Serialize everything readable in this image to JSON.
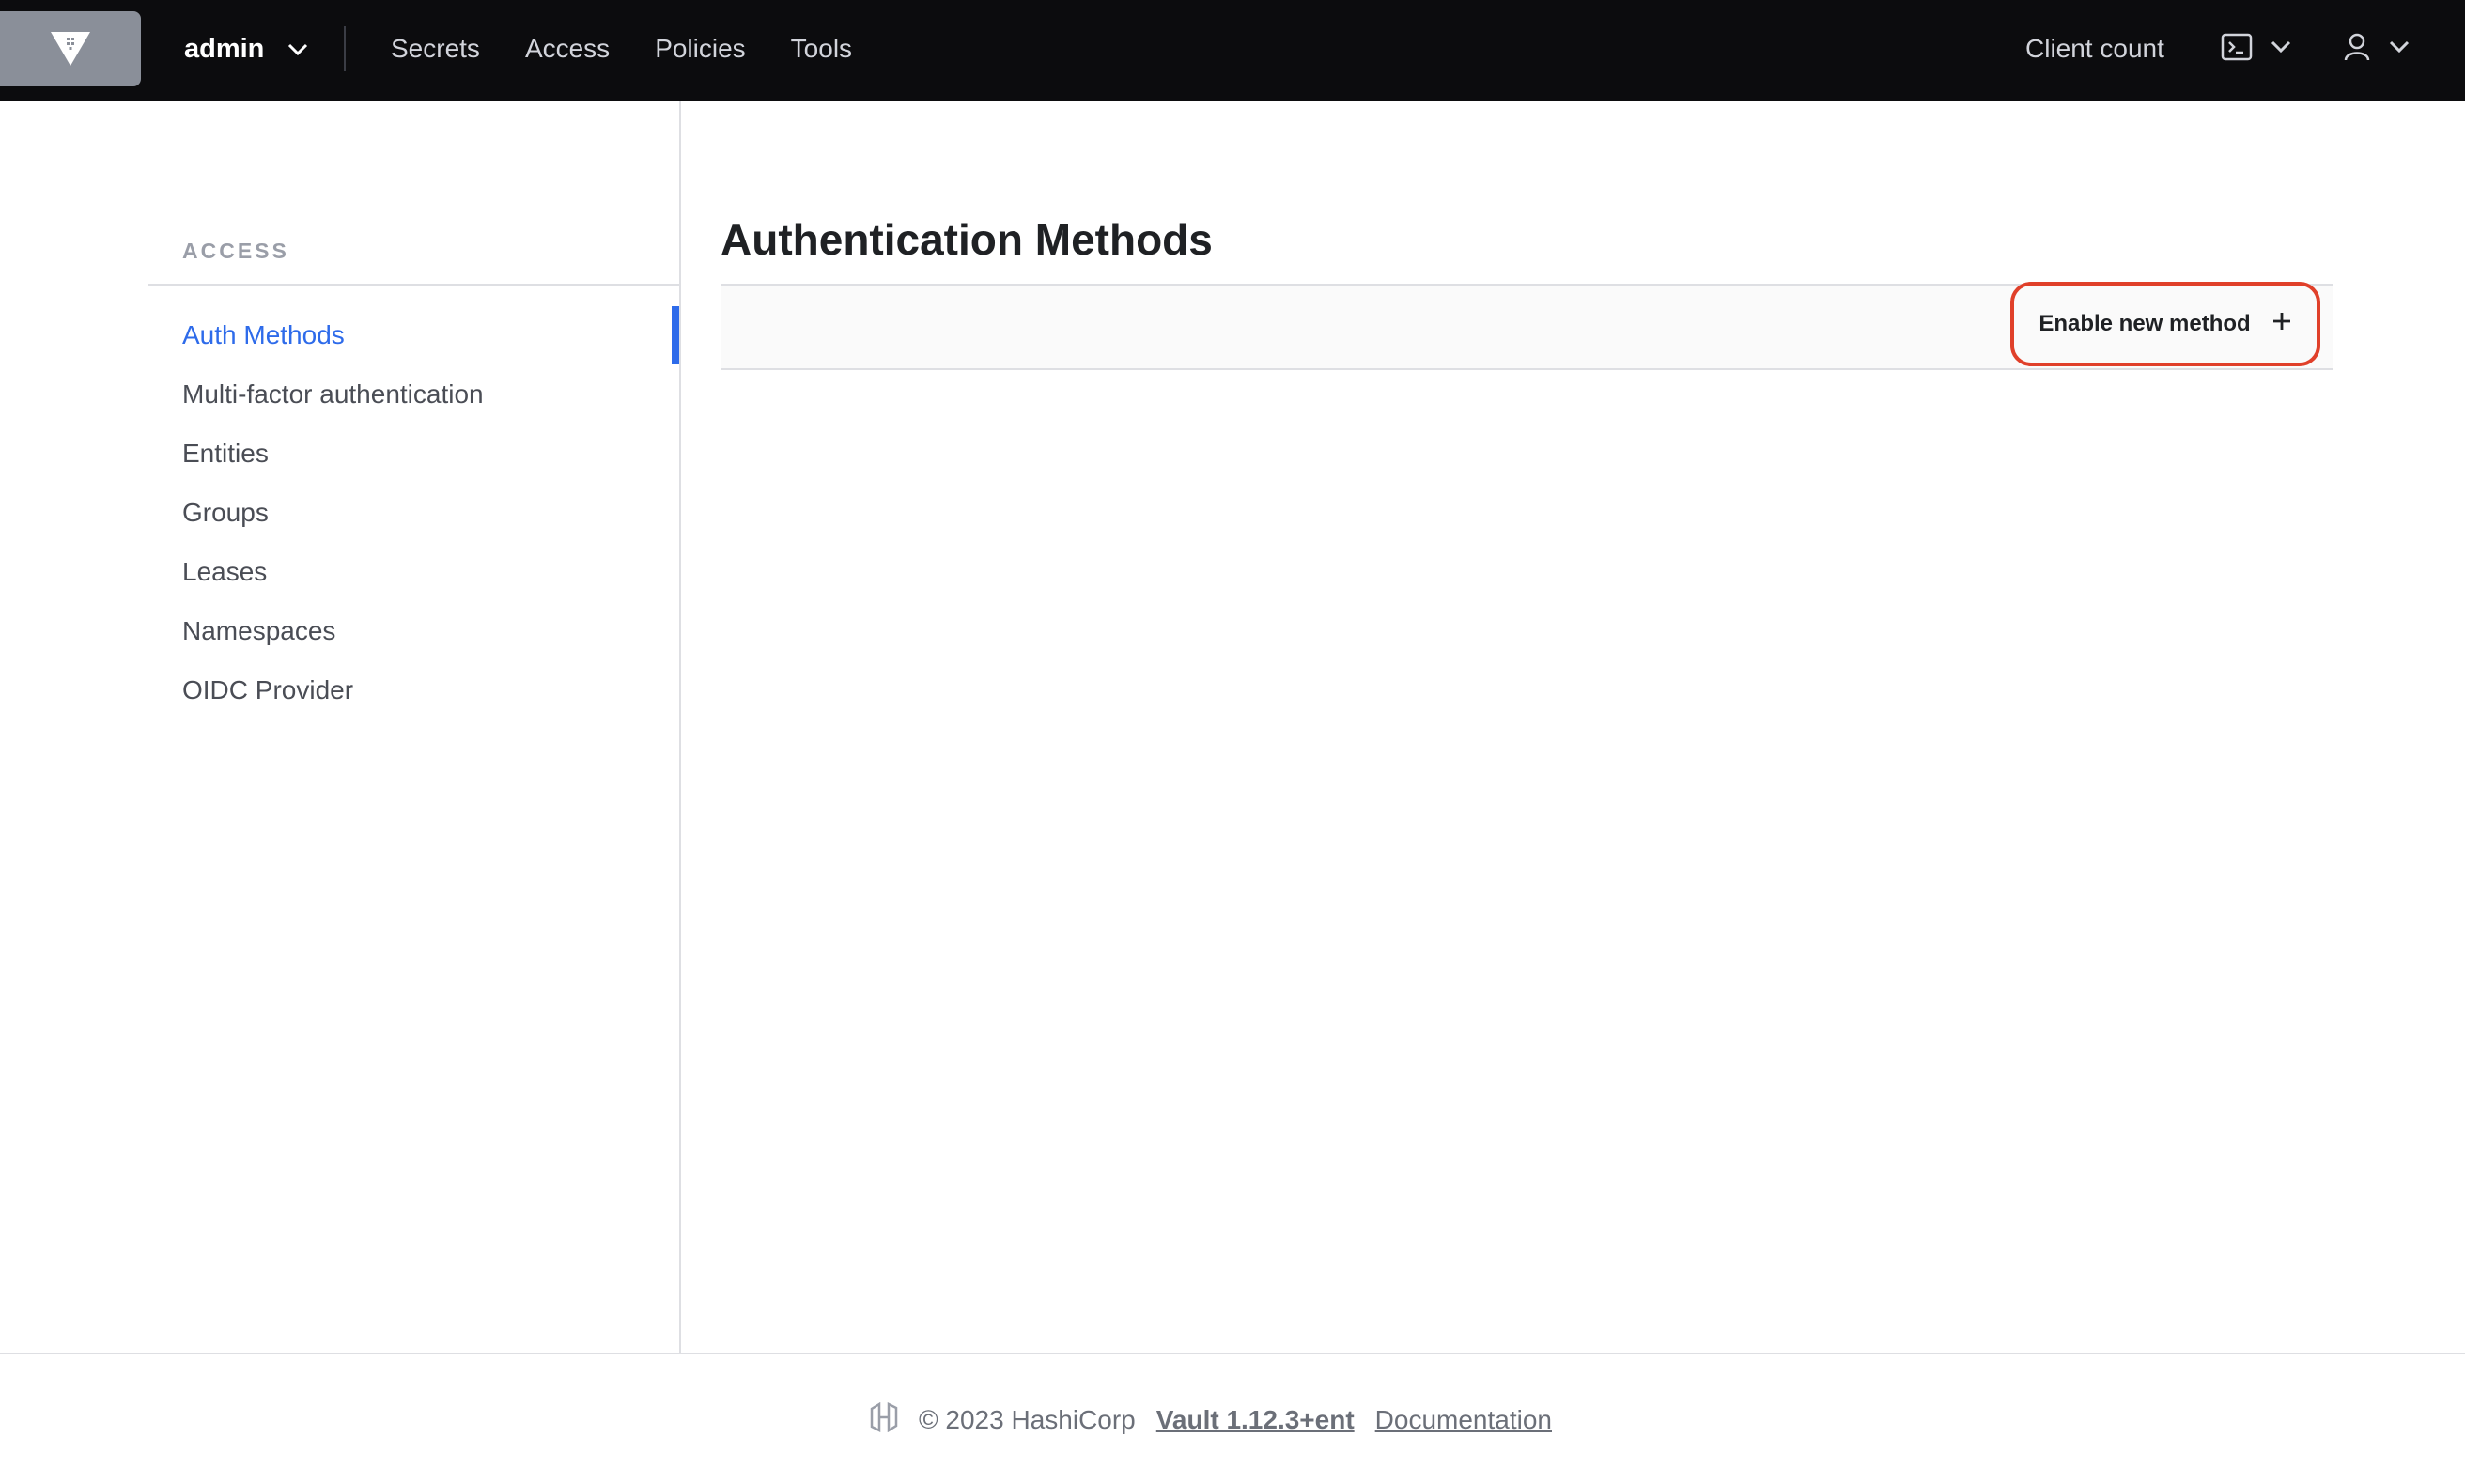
{
  "header": {
    "namespace": "admin",
    "nav_links": [
      "Secrets",
      "Access",
      "Policies",
      "Tools"
    ],
    "client_count": "Client count",
    "icons": {
      "logo": "vault-logo-icon",
      "namespace_caret": "chevron-down-icon",
      "console": "terminal-icon",
      "user": "user-icon"
    }
  },
  "sidebar": {
    "heading": "ACCESS",
    "items": [
      {
        "label": "Auth Methods",
        "active": true
      },
      {
        "label": "Multi-factor authentication",
        "active": false
      },
      {
        "label": "Entities",
        "active": false
      },
      {
        "label": "Groups",
        "active": false
      },
      {
        "label": "Leases",
        "active": false
      },
      {
        "label": "Namespaces",
        "active": false
      },
      {
        "label": "OIDC Provider",
        "active": false
      }
    ]
  },
  "main": {
    "title": "Authentication Methods",
    "enable_button": "Enable new method"
  },
  "footer": {
    "copyright": "© 2023 HashiCorp",
    "version": "Vault 1.12.3+ent",
    "docs": "Documentation"
  },
  "colors": {
    "accent": "#2e6bea",
    "highlight": "#e0402a",
    "nav_bg": "#0c0c0e"
  }
}
